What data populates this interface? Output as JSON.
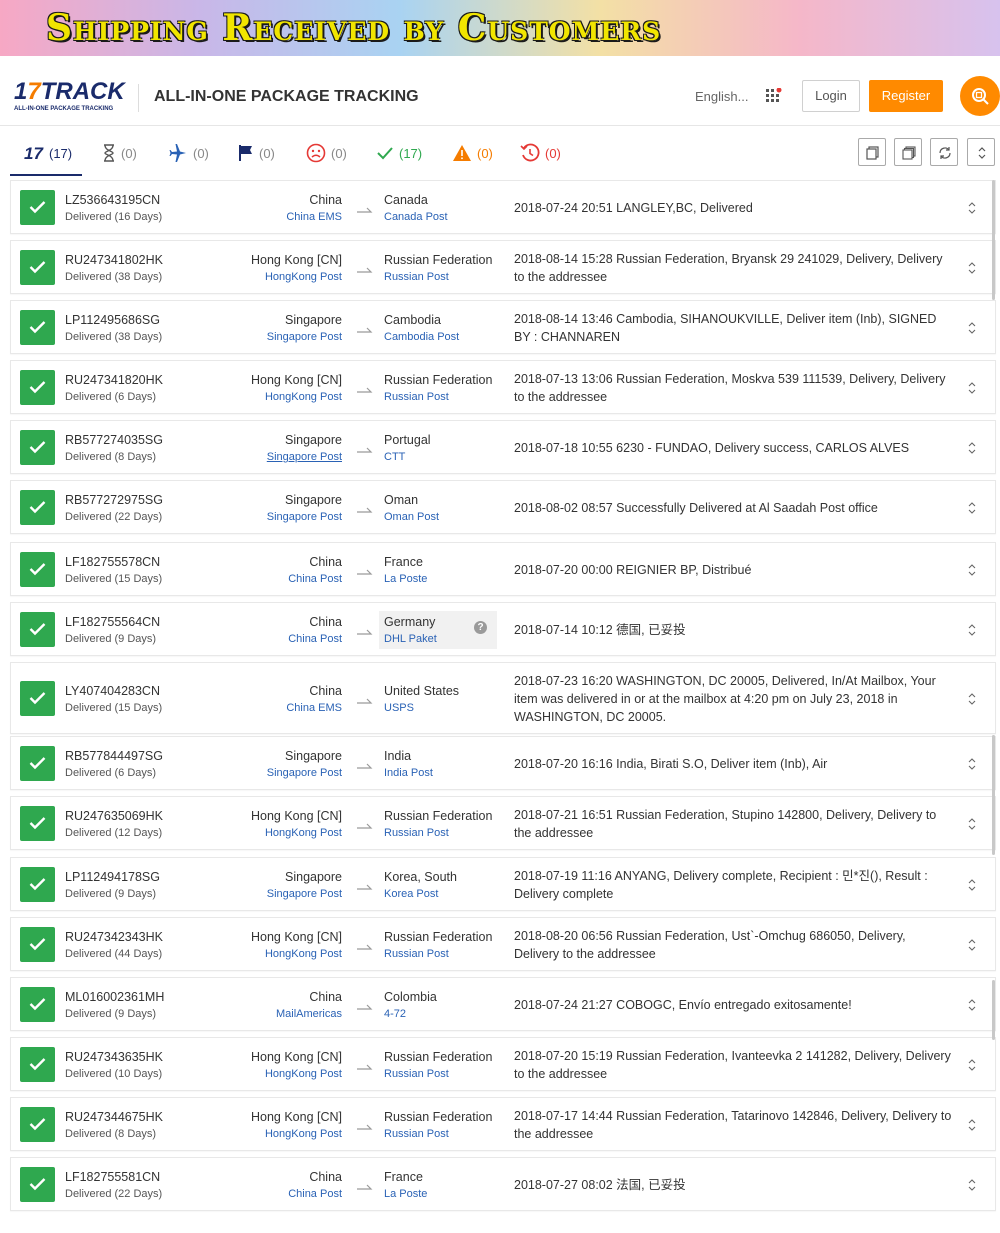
{
  "banner": {
    "title": "Shipping Received by Customers"
  },
  "header": {
    "logo_main": "17TRACK",
    "logo_sub": "ALL-IN-ONE PACKAGE TRACKING",
    "tagline": "ALL-IN-ONE PACKAGE TRACKING",
    "language": "English...",
    "login": "Login",
    "register": "Register"
  },
  "filters": [
    {
      "icon": "17track-all-icon",
      "count": "(17)"
    },
    {
      "icon": "hourglass-icon",
      "count": "(0)"
    },
    {
      "icon": "airplane-icon",
      "count": "(0)"
    },
    {
      "icon": "flag-icon",
      "count": "(0)"
    },
    {
      "icon": "sad-face-icon",
      "count": "(0)"
    },
    {
      "icon": "checkmark-icon",
      "count": "(17)"
    },
    {
      "icon": "warning-icon",
      "count": "(0)"
    },
    {
      "icon": "history-icon",
      "count": "(0)"
    }
  ],
  "shipments": [
    {
      "tracking": "LZ536643195CN",
      "days": "Delivered (16 Days)",
      "origin": "China",
      "origin_carrier": "China EMS",
      "destination": "Canada",
      "dest_carrier": "Canada Post",
      "status": "2018-07-24 20:51  LANGLEY,BC, Delivered"
    },
    {
      "tracking": "RU247341802HK",
      "days": "Delivered (38 Days)",
      "origin": "Hong Kong [CN]",
      "origin_carrier": "HongKong Post",
      "destination": "Russian Federation",
      "dest_carrier": "Russian Post",
      "status": "2018-08-14 15:28  Russian Federation, Bryansk 29 241029, Delivery, Delivery to the addressee"
    },
    {
      "tracking": "LP112495686SG",
      "days": "Delivered (38 Days)",
      "origin": "Singapore",
      "origin_carrier": "Singapore Post",
      "destination": "Cambodia",
      "dest_carrier": "Cambodia Post",
      "status": "2018-08-14 13:46  Cambodia, SIHANOUKVILLE, Deliver item (Inb), SIGNED BY : CHANNAREN"
    },
    {
      "tracking": "RU247341820HK",
      "days": "Delivered (6 Days)",
      "origin": "Hong Kong [CN]",
      "origin_carrier": "HongKong Post",
      "destination": "Russian Federation",
      "dest_carrier": "Russian Post",
      "status": "2018-07-13 13:06  Russian Federation, Moskva 539 111539, Delivery, Delivery to the addressee"
    },
    {
      "tracking": "RB577274035SG",
      "days": "Delivered (8 Days)",
      "origin": "Singapore",
      "origin_carrier": "Singapore Post",
      "destination": "Portugal",
      "dest_carrier": "CTT",
      "status": "2018-07-18 10:55  6230 - FUNDAO, Delivery success, CARLOS ALVES"
    },
    {
      "tracking": "RB577272975SG",
      "days": "Delivered (22 Days)",
      "origin": "Singapore",
      "origin_carrier": "Singapore Post",
      "destination": "Oman",
      "dest_carrier": "Oman Post",
      "status": "2018-08-02 08:57   Successfully Delivered at Al Saadah Post office"
    },
    {
      "tracking": "LF182755578CN",
      "days": "Delivered (15 Days)",
      "origin": "China",
      "origin_carrier": "China Post",
      "destination": "France",
      "dest_carrier": "La Poste",
      "status": "2018-07-20 00:00  REIGNIER BP, Distribué"
    },
    {
      "tracking": "LF182755564CN",
      "days": "Delivered (9 Days)",
      "origin": "China",
      "origin_carrier": "China Post",
      "destination": "Germany",
      "dest_carrier": "DHL Paket",
      "status": "2018-07-14 10:12  德国, 已妥投"
    },
    {
      "tracking": "LY407404283CN",
      "days": "Delivered (15 Days)",
      "origin": "China",
      "origin_carrier": "China EMS",
      "destination": "United States",
      "dest_carrier": "USPS",
      "status": "2018-07-23 16:20   WASHINGTON, DC 20005, Delivered, In/At Mailbox, Your item was delivered in or at the mailbox at 4:20 pm on July 23, 2018 in WASHINGTON, DC 20005."
    },
    {
      "tracking": "RB577844497SG",
      "days": "Delivered (6 Days)",
      "origin": "Singapore",
      "origin_carrier": "Singapore Post",
      "destination": "India",
      "dest_carrier": "India Post",
      "status": "2018-07-20 16:16  India, Birati S.O, Deliver item (Inb), Air"
    },
    {
      "tracking": "RU247635069HK",
      "days": "Delivered (12 Days)",
      "origin": "Hong Kong [CN]",
      "origin_carrier": "HongKong Post",
      "destination": "Russian Federation",
      "dest_carrier": "Russian Post",
      "status": "2018-07-21 16:51  Russian Federation, Stupino 142800, Delivery, Delivery to the addressee"
    },
    {
      "tracking": "LP112494178SG",
      "days": "Delivered (9 Days)",
      "origin": "Singapore",
      "origin_carrier": "Singapore Post",
      "destination": "Korea, South",
      "dest_carrier": "Korea Post",
      "status": "2018-07-19 11:16  ANYANG, Delivery complete, Recipient : 민*진(), Result : Delivery complete"
    },
    {
      "tracking": "RU247342343HK",
      "days": "Delivered (44 Days)",
      "origin": "Hong Kong [CN]",
      "origin_carrier": "HongKong Post",
      "destination": "Russian Federation",
      "dest_carrier": "Russian Post",
      "status": "2018-08-20 06:56  Russian Federation, Ust`-Omchug 686050, Delivery, Delivery to the addressee"
    },
    {
      "tracking": "ML016002361MH",
      "days": "Delivered (9 Days)",
      "origin": "China",
      "origin_carrier": "MailAmericas",
      "destination": "Colombia",
      "dest_carrier": "4-72",
      "status": "2018-07-24 21:27  COBOGC, Envío entregado exitosamente!"
    },
    {
      "tracking": "RU247343635HK",
      "days": "Delivered (10 Days)",
      "origin": "Hong Kong [CN]",
      "origin_carrier": "HongKong Post",
      "destination": "Russian Federation",
      "dest_carrier": "Russian Post",
      "status": "2018-07-20 15:19  Russian Federation, Ivanteevka 2 141282, Delivery, Delivery to the addressee"
    },
    {
      "tracking": "RU247344675HK",
      "days": "Delivered (8 Days)",
      "origin": "Hong Kong [CN]",
      "origin_carrier": "HongKong Post",
      "destination": "Russian Federation",
      "dest_carrier": "Russian Post",
      "status": "2018-07-17 14:44  Russian Federation, Tatarinovo 142846, Delivery, Delivery to the addressee"
    },
    {
      "tracking": "LF182755581CN",
      "days": "Delivered (22 Days)",
      "origin": "China",
      "origin_carrier": "China Post",
      "destination": "France",
      "dest_carrier": "La Poste",
      "status": "2018-07-27 08:02  法国, 已妥投"
    }
  ],
  "colors": {
    "accent": "#ff8a00",
    "brand": "#1a2b6b",
    "delivered": "#2fa84f",
    "link": "#2a62b5"
  }
}
